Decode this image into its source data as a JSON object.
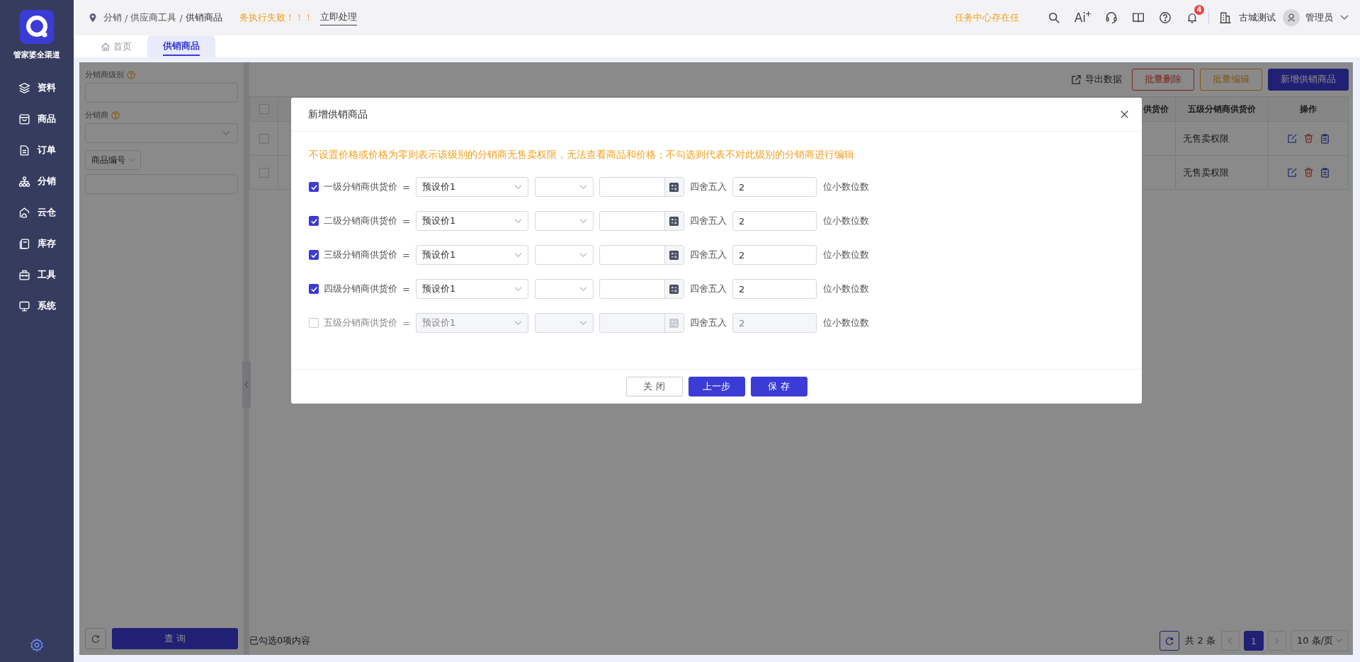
{
  "sidebar": {
    "brand": "管家婆全渠道",
    "items": [
      {
        "label": "资料"
      },
      {
        "label": "商品"
      },
      {
        "label": "订单"
      },
      {
        "label": "分销"
      },
      {
        "label": "云仓"
      },
      {
        "label": "库存"
      },
      {
        "label": "工具"
      },
      {
        "label": "系统"
      }
    ]
  },
  "topbar": {
    "breadcrumb": [
      "分销",
      "供应商工具",
      "供销商品"
    ],
    "separator": "/",
    "alert": "务执行失败！！！",
    "alert_action": "立即处理",
    "notice": "任务中心存在任",
    "ai_label": "Ai",
    "notification_count": "4",
    "company": "古城测试",
    "user": "管理员"
  },
  "tabs": [
    {
      "label": "首页",
      "selected": false
    },
    {
      "label": "供销商品",
      "selected": true
    }
  ],
  "filters": {
    "level_label": "分销商级别",
    "distributor_label": "分销商",
    "code_field": "商品编号",
    "query_button": "查 询"
  },
  "toolbar": {
    "export": "导出数据",
    "buttons": [
      {
        "label": "批量删除",
        "kind": "danger"
      },
      {
        "label": "批量编辑",
        "kind": "warning"
      },
      {
        "label": "新增供销商品",
        "kind": "primary"
      }
    ]
  },
  "table": {
    "columns": [
      "供货价",
      "五级分销商供货价",
      "操作"
    ],
    "header_checked": false,
    "rows": [
      {
        "checked": false,
        "cells": [
          "无售卖权限"
        ]
      },
      {
        "checked": false,
        "cells": [
          "无售卖权限"
        ]
      }
    ]
  },
  "footer": {
    "selection": "已勾选0项内容",
    "total": "共 2 条",
    "pages": [
      {
        "label": "1",
        "selected": true
      }
    ],
    "page_size": "10 条/页"
  },
  "modal": {
    "title": "新增供销商品",
    "notice": "不设置价格或价格为零则表示该级别的分销商无售卖权限，无法查看商品和价格；不勾选则代表不对此级别的分销商进行编辑",
    "rows": [
      {
        "label": "一级分销商供货价",
        "checked": true,
        "equals": "=",
        "price": "预设价1",
        "rounding": "四舍五入",
        "decimals": "2",
        "suffix": "位小数位数"
      },
      {
        "label": "二级分销商供货价",
        "checked": true,
        "equals": "=",
        "price": "预设价1",
        "rounding": "四舍五入",
        "decimals": "2",
        "suffix": "位小数位数"
      },
      {
        "label": "三级分销商供货价",
        "checked": true,
        "equals": "=",
        "price": "预设价1",
        "rounding": "四舍五入",
        "decimals": "2",
        "suffix": "位小数位数"
      },
      {
        "label": "四级分销商供货价",
        "checked": true,
        "equals": "=",
        "price": "预设价1",
        "rounding": "四舍五入",
        "decimals": "2",
        "suffix": "位小数位数"
      },
      {
        "label": "五级分销商供货价",
        "checked": false,
        "equals": "=",
        "price": "预设价1",
        "rounding": "四舍五入",
        "decimals": "2",
        "suffix": "位小数位数"
      }
    ],
    "buttons": [
      {
        "label": "关 闭",
        "kind": "default"
      },
      {
        "label": "上一步",
        "kind": "primary"
      },
      {
        "label": "保 存",
        "kind": "primary"
      }
    ]
  }
}
